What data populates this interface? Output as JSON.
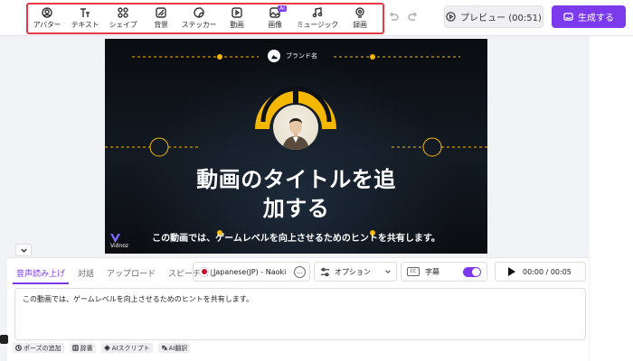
{
  "toolbar": {
    "items": [
      {
        "label": "アバター",
        "icon": "avatar-icon"
      },
      {
        "label": "テキスト",
        "icon": "text-icon"
      },
      {
        "label": "シェイプ",
        "icon": "shapes-icon"
      },
      {
        "label": "背景",
        "icon": "background-icon"
      },
      {
        "label": "ステッカー",
        "icon": "sticker-icon"
      },
      {
        "label": "動画",
        "icon": "video-icon"
      },
      {
        "label": "画像",
        "icon": "image-icon",
        "badge": "AI"
      },
      {
        "label": "ミュージック",
        "icon": "music-icon"
      },
      {
        "label": "録画",
        "icon": "record-icon"
      }
    ]
  },
  "header": {
    "preview_label": "プレビュー (00:51)",
    "generate_label": "生成する"
  },
  "canvas": {
    "brand_name": "ブランド名",
    "title_line1": "動画のタイトルを追",
    "title_line2": "加する",
    "subtitle": "この動画では、ゲームレベルを向上させるためのヒントを共有します。",
    "watermark": "Vidnoz",
    "accent_color": "#f5b800"
  },
  "script_panel": {
    "tabs": [
      "音声読み上げ",
      "対話",
      "アップロード",
      "スピーチなし"
    ],
    "active_tab": "音声読み上げ",
    "voice": "Japanese(JP) - Naoki",
    "more_label": "...",
    "option_label": "オプション",
    "subtitle_label": "字幕",
    "cc_label": "CC",
    "subtitle_enabled": true,
    "time": "00:00 / 00:05",
    "script_text": "この動画では、ゲームレベルを向上させるためのヒントを共有します。",
    "chips": [
      "ポーズの追加",
      "辞書",
      "AIスクリプト",
      "AI翻訳"
    ]
  },
  "colors": {
    "brand": "#7c3aed",
    "highlight_border": "#e53945"
  }
}
